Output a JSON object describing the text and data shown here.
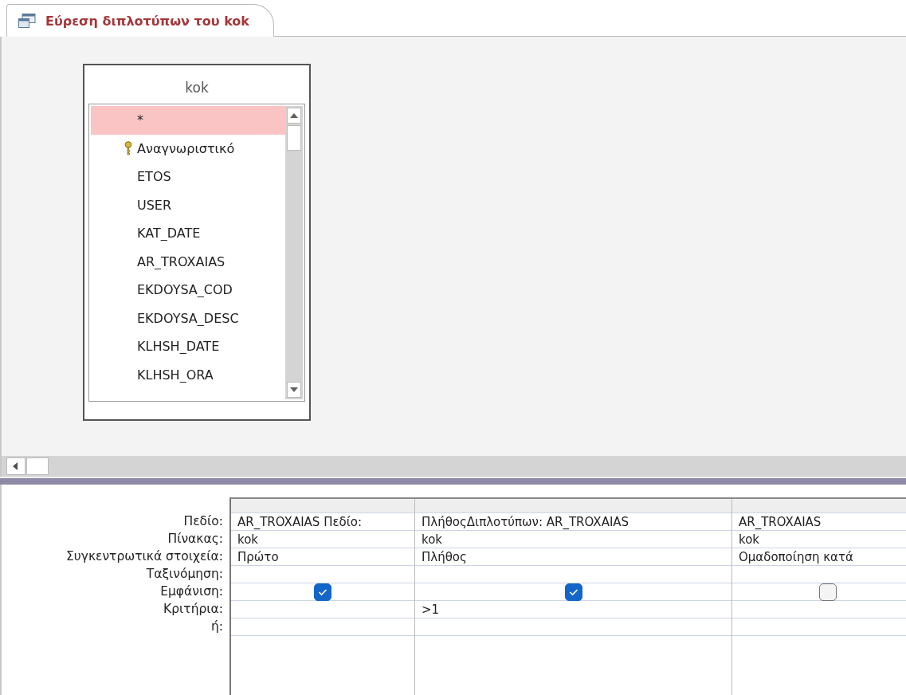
{
  "tab": {
    "title": "Εύρεση διπλοτύπων του kok",
    "selected": true
  },
  "field_list": {
    "title": "kok",
    "items": [
      {
        "name": "*",
        "primary_key": false,
        "selected": true
      },
      {
        "name": "Αναγνωριστικό",
        "primary_key": true,
        "selected": false
      },
      {
        "name": "ETOS",
        "primary_key": false,
        "selected": false
      },
      {
        "name": "USER",
        "primary_key": false,
        "selected": false
      },
      {
        "name": "KAT_DATE",
        "primary_key": false,
        "selected": false
      },
      {
        "name": "AR_TROXAIAS",
        "primary_key": false,
        "selected": false
      },
      {
        "name": "EKDOYSA_COD",
        "primary_key": false,
        "selected": false
      },
      {
        "name": "EKDOYSA_DESC",
        "primary_key": false,
        "selected": false
      },
      {
        "name": "KLHSH_DATE",
        "primary_key": false,
        "selected": false
      },
      {
        "name": "KLHSH_ORA",
        "primary_key": false,
        "selected": false
      }
    ]
  },
  "grid": {
    "rows": [
      {
        "label": "Πεδίο:",
        "kind": "text",
        "cells": [
          "AR_TROXAIAS Πεδίο:",
          "ΠλήθοςΔιπλοτύπων: AR_TROXAIAS",
          "AR_TROXAIAS"
        ]
      },
      {
        "label": "Πίνακας:",
        "kind": "text",
        "cells": [
          "kok",
          "kok",
          "kok"
        ]
      },
      {
        "label": "Συγκεντρωτικά στοιχεία:",
        "kind": "text",
        "cells": [
          "Πρώτο",
          "Πλήθος",
          "Ομαδοποίηση κατά"
        ]
      },
      {
        "label": "Ταξινόμηση:",
        "kind": "text",
        "cells": [
          null,
          null,
          null
        ]
      },
      {
        "label": "Εμφάνιση:",
        "kind": "checkbox",
        "cells": [
          {
            "checked": true
          },
          {
            "checked": true
          },
          {
            "checked": false
          }
        ]
      },
      {
        "label": "Κριτήρια:",
        "kind": "text",
        "cells": [
          null,
          ">1",
          null
        ]
      },
      {
        "label": "ή:",
        "kind": "text",
        "cells": [
          null,
          null,
          null
        ]
      }
    ]
  }
}
